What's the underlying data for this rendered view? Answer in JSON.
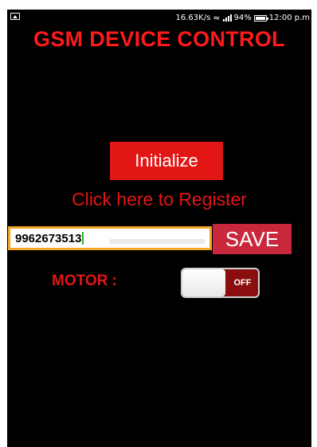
{
  "status_bar": {
    "speed": "16.63K/s",
    "battery": "94%",
    "time": "12:00 p.m",
    "icons": [
      "image-icon",
      "wifi-icon",
      "signal-icon",
      "battery-icon"
    ]
  },
  "app": {
    "title": "GSM DEVICE CONTROL",
    "initialize_label": "Initialize",
    "register_link": "Click here to Register",
    "phone_value": "9962673513",
    "save_label": "SAVE",
    "motor_label": "MOTOR :",
    "motor_state": "OFF"
  },
  "colors": {
    "accent_red": "#e31616",
    "save_red": "#c9283c",
    "input_border": "#f5a623",
    "background": "#000000"
  }
}
